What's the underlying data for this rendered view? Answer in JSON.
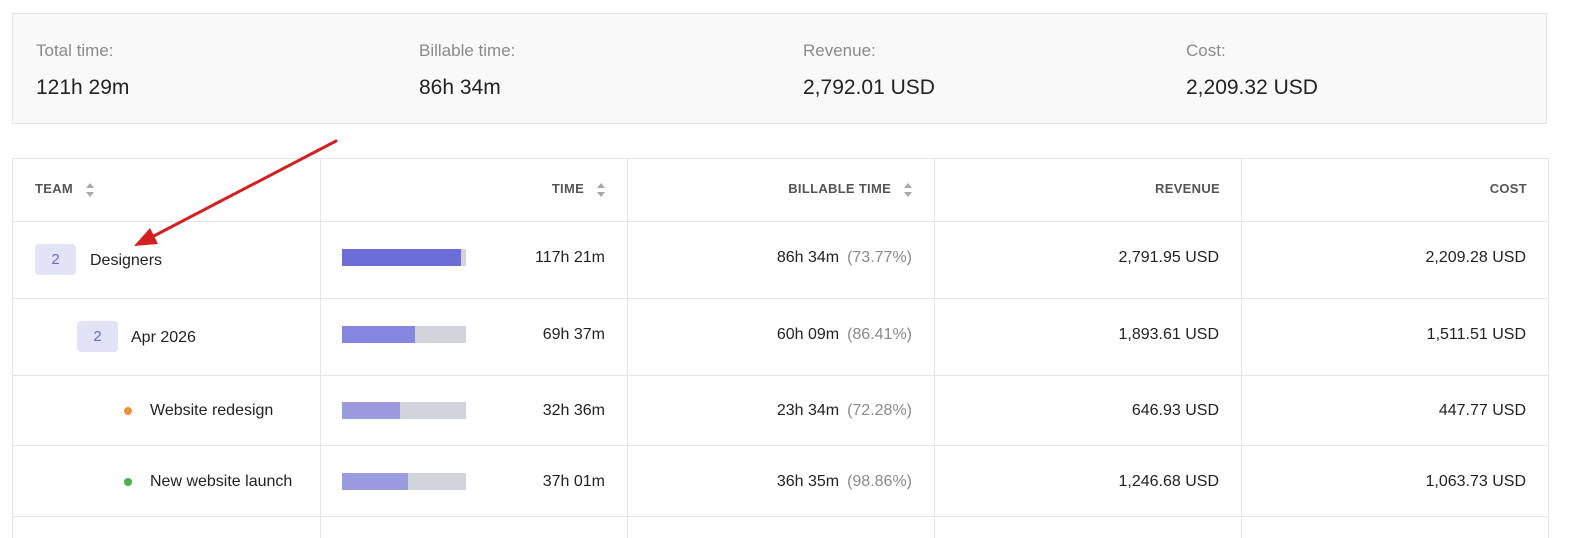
{
  "summary": {
    "total_time": {
      "label": "Total time:",
      "value": "121h 29m"
    },
    "billable_time": {
      "label": "Billable time:",
      "value": "86h 34m"
    },
    "revenue": {
      "label": "Revenue:",
      "value": "2,792.01 USD"
    },
    "cost": {
      "label": "Cost:",
      "value": "2,209.32 USD"
    }
  },
  "table": {
    "headers": {
      "team": "TEAM",
      "time": "TIME",
      "billable_time": "BILLABLE TIME",
      "revenue": "REVENUE",
      "cost": "COST"
    },
    "rows": [
      {
        "badge": "2",
        "name": "Designers",
        "bar_fill": 0.96,
        "bar_color": "#6c6dd6",
        "time": "117h 21m",
        "billable": "86h 34m",
        "billable_pct": "(73.77%)",
        "revenue": "2,791.95 USD",
        "cost": "2,209.28 USD"
      },
      {
        "badge": "2",
        "name": "Apr 2026",
        "bar_fill": 0.59,
        "bar_color": "#8586e0",
        "time": "69h 37m",
        "billable": "60h 09m",
        "billable_pct": "(86.41%)",
        "revenue": "1,893.61 USD",
        "cost": "1,511.51 USD"
      },
      {
        "dot_color": "#f0923a",
        "name": "Website redesign",
        "bar_fill": 0.47,
        "bar_color": "#9b9cdf",
        "time": "32h 36m",
        "billable": "23h 34m",
        "billable_pct": "(72.28%)",
        "revenue": "646.93 USD",
        "cost": "447.77 USD"
      },
      {
        "dot_color": "#4caf50",
        "name": "New website launch",
        "bar_fill": 0.53,
        "bar_color": "#9b9cdf",
        "time": "37h 01m",
        "billable": "36h 35m",
        "billable_pct": "(98.86%)",
        "revenue": "1,246.68 USD",
        "cost": "1,063.73 USD"
      }
    ]
  },
  "annotation": {
    "arrow_color": "#d42020"
  }
}
